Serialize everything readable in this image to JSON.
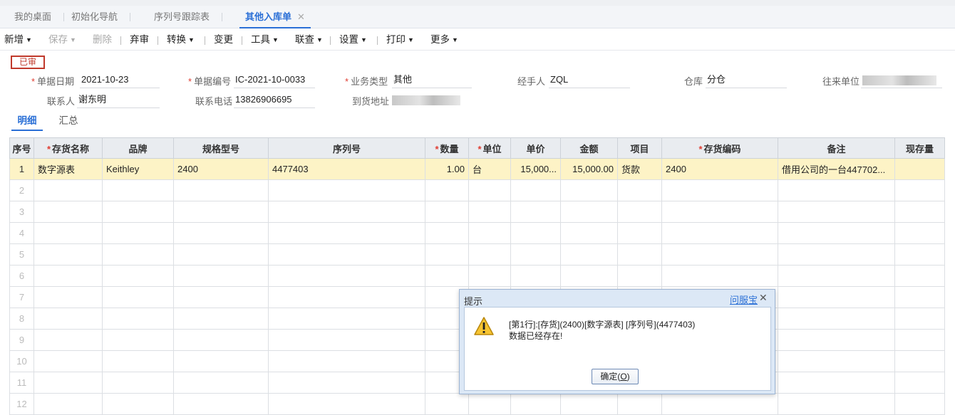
{
  "tabs": [
    {
      "label": "我的桌面"
    },
    {
      "label": "初始化导航"
    },
    {
      "label": "序列号跟踪表"
    },
    {
      "label": "其他入库单",
      "close": "✕"
    }
  ],
  "toolbar": {
    "add": "新增",
    "save": "保存",
    "delete": "删除",
    "abandon": "弃审",
    "convert": "转换",
    "change": "变更",
    "tools": "工具",
    "link": "联查",
    "settings": "设置",
    "print": "打印",
    "more": "更多",
    "caret": "▼"
  },
  "status_stamp": "已审",
  "form": {
    "date_label": "单据日期",
    "date_value": "2021-10-23",
    "code_label": "单据编号",
    "code_value": "IC-2021-10-0033",
    "biztype_label": "业务类型",
    "biztype_value": "其他",
    "handler_label": "经手人",
    "handler_value": "ZQL",
    "warehouse_label": "仓库",
    "warehouse_value": "分仓",
    "partner_label": "往来单位",
    "contact_label": "联系人",
    "contact_value": "谢东明",
    "phone_label": "联系电话",
    "phone_value": "13826906695",
    "address_label": "到货地址"
  },
  "subtabs": {
    "detail": "明细",
    "summary": "汇总"
  },
  "grid": {
    "headers": [
      {
        "label": "序号",
        "req": false
      },
      {
        "label": "存货名称",
        "req": true
      },
      {
        "label": "品牌",
        "req": false
      },
      {
        "label": "规格型号",
        "req": false
      },
      {
        "label": "序列号",
        "req": false
      },
      {
        "label": "数量",
        "req": true
      },
      {
        "label": "单位",
        "req": true
      },
      {
        "label": "单价",
        "req": false
      },
      {
        "label": "金额",
        "req": false
      },
      {
        "label": "项目",
        "req": false
      },
      {
        "label": "存货编码",
        "req": true
      },
      {
        "label": "备注",
        "req": false
      },
      {
        "label": "现存量",
        "req": false
      }
    ],
    "rows": [
      [
        "1",
        "数字源表",
        "Keithley",
        "2400",
        "4477403",
        "1.00",
        "台",
        "15,000...",
        "15,000.00",
        "货款",
        "2400",
        "借用公司的一台447702...",
        ""
      ],
      [
        "2",
        "",
        "",
        "",
        "",
        "",
        "",
        "",
        "",
        "",
        "",
        "",
        ""
      ],
      [
        "3",
        "",
        "",
        "",
        "",
        "",
        "",
        "",
        "",
        "",
        "",
        "",
        ""
      ],
      [
        "4",
        "",
        "",
        "",
        "",
        "",
        "",
        "",
        "",
        "",
        "",
        "",
        ""
      ],
      [
        "5",
        "",
        "",
        "",
        "",
        "",
        "",
        "",
        "",
        "",
        "",
        "",
        ""
      ],
      [
        "6",
        "",
        "",
        "",
        "",
        "",
        "",
        "",
        "",
        "",
        "",
        "",
        ""
      ],
      [
        "7",
        "",
        "",
        "",
        "",
        "",
        "",
        "",
        "",
        "",
        "",
        "",
        ""
      ],
      [
        "8",
        "",
        "",
        "",
        "",
        "",
        "",
        "",
        "",
        "",
        "",
        "",
        ""
      ],
      [
        "9",
        "",
        "",
        "",
        "",
        "",
        "",
        "",
        "",
        "",
        "",
        "",
        ""
      ],
      [
        "10",
        "",
        "",
        "",
        "",
        "",
        "",
        "",
        "",
        "",
        "",
        "",
        ""
      ],
      [
        "11",
        "",
        "",
        "",
        "",
        "",
        "",
        "",
        "",
        "",
        "",
        "",
        ""
      ],
      [
        "12",
        "",
        "",
        "",
        "",
        "",
        "",
        "",
        "",
        "",
        "",
        "",
        ""
      ]
    ]
  },
  "dialog": {
    "title": "提示",
    "help": "问服宝",
    "close": "✕",
    "line1": "[第1行]:[存货](2400)[数字源表] [序列号](4477403)",
    "line2": "数据已经存在!",
    "ok_text": "确定(",
    "ok_key": "O",
    "ok_end": ")"
  }
}
